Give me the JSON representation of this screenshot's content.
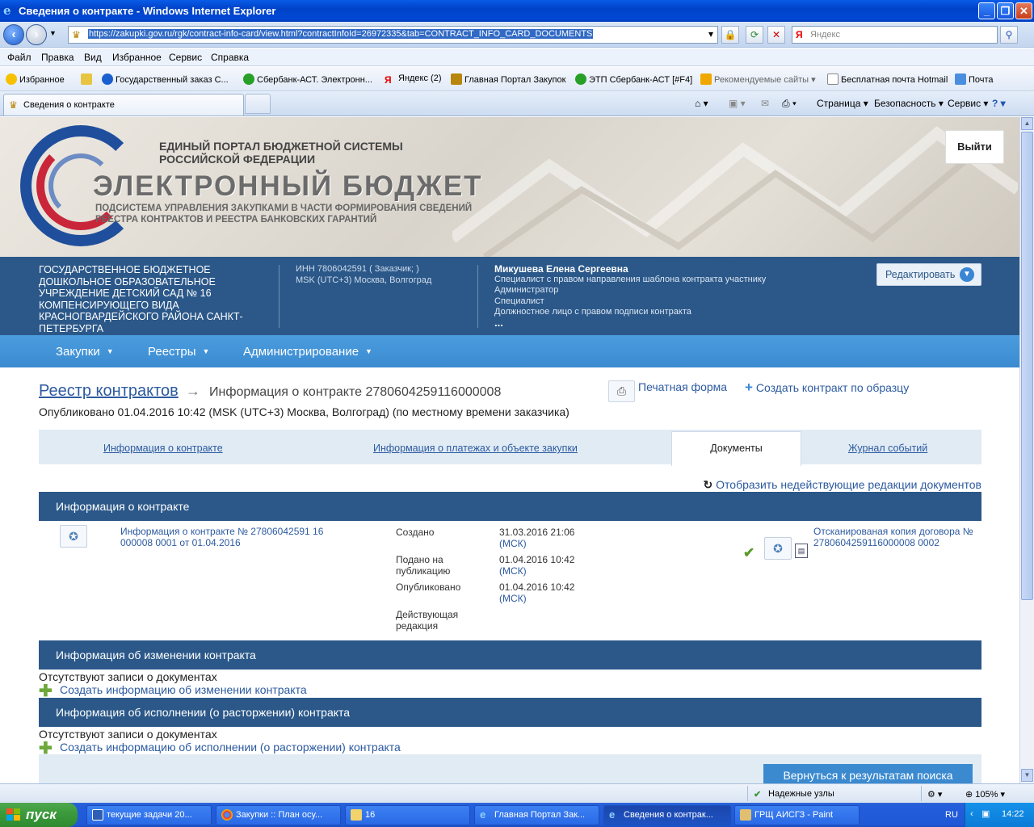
{
  "window": {
    "title": "Сведения о контракте - Windows Internet Explorer",
    "url": "https://zakupki.gov.ru/rgk/contract-info-card/view.html?contractInfoId=26972335&tab=CONTRACT_INFO_CARD_DOCUMENTS",
    "search_placeholder": "Яндекс"
  },
  "menubar": [
    "Файл",
    "Правка",
    "Вид",
    "Избранное",
    "Сервис",
    "Справка"
  ],
  "favorites": {
    "label": "Избранное",
    "items": [
      "Государственный заказ С...",
      "Сбербанк-АСТ. Электронн...",
      "Яндекс (2)",
      "Главная Портал Закупок",
      "ЭТП Сбербанк-АСТ [#F4]",
      "Рекомендуемые сайты",
      "Бесплатная почта Hotmail",
      "Почта"
    ]
  },
  "tab": {
    "label": "Сведения о контракте"
  },
  "commandbar": {
    "page": "Страница",
    "security": "Безопасность",
    "service": "Сервис"
  },
  "portal": {
    "title_line1": "ЕДИНЫЙ ПОРТАЛ БЮДЖЕТНОЙ СИСТЕМЫ",
    "title_line2": "РОССИЙСКОЙ ФЕДЕРАЦИИ",
    "big": "ЭЛЕКТРОННЫЙ БЮДЖЕТ",
    "sub_line1": "ПОДСИСТЕМА УПРАВЛЕНИЯ ЗАКУПКАМИ В ЧАСТИ ФОРМИРОВАНИЯ СВЕДЕНИЙ",
    "sub_line2": "РЕЕСТРА КОНТРАКТОВ И РЕЕСТРА БАНКОВСКИХ ГАРАНТИЙ",
    "logout": "Выйти"
  },
  "org": {
    "name": "ГОСУДАРСТВЕННОЕ БЮДЖЕТНОЕ ДОШКОЛЬНОЕ ОБРАЗОВАТЕЛЬНОЕ УЧРЕЖДЕНИЕ ДЕТСКИЙ САД № 16 КОМПЕНСИРУЮЩЕГО ВИДА КРАСНОГВАРДЕЙСКОГО РАЙОНА САНКТ-ПЕТЕРБУРГА",
    "inn": "ИНН 7806042591 ( Заказчик; )",
    "tz": "MSK (UTC+3) Москва, Волгоград",
    "user_name": "Микушева Елена Сергеевна",
    "roles": [
      "Специалист с правом направления шаблона контракта участнику",
      "Администратор",
      "Специалист",
      "Должностное лицо с правом подписи контракта"
    ],
    "more": "...",
    "edit": "Редактировать"
  },
  "nav": [
    "Закупки",
    "Реестры",
    "Администрирование"
  ],
  "content": {
    "crumb_root": "Реестр контрактов",
    "crumb_current": "Информация о контракте 2780604259116000008",
    "print": "Печатная форма",
    "create": "Создать контракт по образцу",
    "published": "Опубликовано 01.04.2016 10:42 (MSK (UTC+3) Москва, Волгоград) (по местному времени заказчика)",
    "tabs": [
      "Информация о контракте",
      "Информация о платежах и объекте закупки",
      "Документы",
      "Журнал событий"
    ],
    "show_inactive": "Отобразить недействующие редакции документов",
    "sec1": "Информация о контракте",
    "doc1_link": "Информация о контракте № 27806042591 16 000008 0001 от 01.04.2016",
    "meta": [
      {
        "label": "Создано",
        "value": "31.03.2016 21:06",
        "tz": "(МСК)"
      },
      {
        "label": "Подано на публикацию",
        "value": "01.04.2016 10:42",
        "tz": "(МСК)"
      },
      {
        "label": "Опубликовано",
        "value": "01.04.2016 10:42",
        "tz": "(МСК)"
      },
      {
        "label": "Действующая редакция",
        "value": "",
        "tz": ""
      }
    ],
    "doc2_link": "Отсканированая копия договора № 2780604259116000008 0002",
    "sec2": "Информация об изменении контракта",
    "empty": "Отсутствуют записи о документах",
    "add2": "Создать информацию об изменении контракта",
    "sec3": "Информация об исполнении (о расторжении) контракта",
    "add3": "Создать информацию об исполнении (о расторжении) контракта",
    "back": "Вернуться к результатам поиска"
  },
  "status": {
    "zone": "Надежные узлы",
    "zoom": "105%"
  },
  "taskbar": {
    "start": "пуск",
    "tasks": [
      "текущие задачи 20...",
      "Закупки :: План осу...",
      "16",
      "Главная Портал Зак...",
      "Сведения о контрак...",
      "ГРЩ АИСГЗ - Paint"
    ],
    "lang": "RU",
    "time": "14:22"
  },
  "colors": {
    "header_band": "#2b5889",
    "nav_band": "#3b8ad0",
    "link": "#2c5aa0"
  }
}
